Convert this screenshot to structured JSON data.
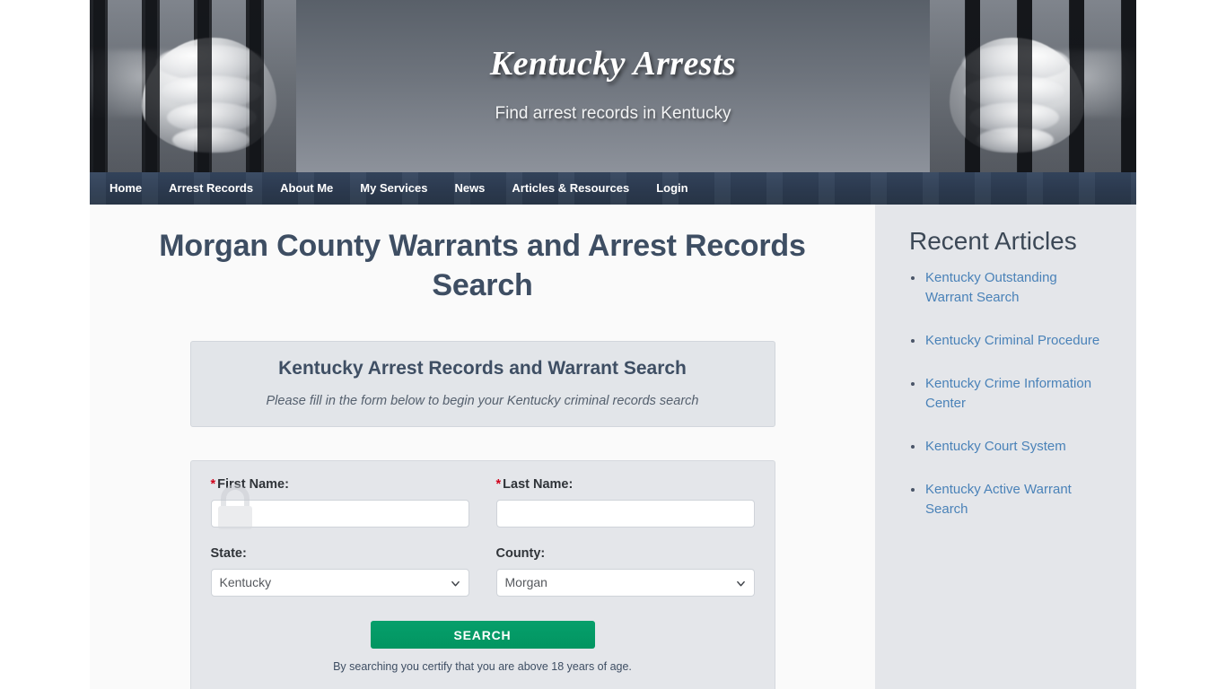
{
  "site": {
    "title": "Kentucky Arrests",
    "tagline": "Find arrest records in Kentucky"
  },
  "nav": {
    "items": [
      {
        "label": "Home"
      },
      {
        "label": "Arrest Records"
      },
      {
        "label": "About Me"
      },
      {
        "label": "My Services"
      },
      {
        "label": "News"
      },
      {
        "label": "Articles & Resources"
      },
      {
        "label": "Login"
      }
    ]
  },
  "main": {
    "page_title": "Morgan County Warrants and Arrest Records Search",
    "intro": {
      "title": "Kentucky Arrest Records and Warrant Search",
      "subtitle": "Please fill in the form below to begin your Kentucky criminal records search"
    },
    "form": {
      "first_name": {
        "label": "First Name:",
        "required_marker": "*",
        "value": "",
        "placeholder": ""
      },
      "last_name": {
        "label": "Last Name:",
        "required_marker": "*",
        "value": "",
        "placeholder": ""
      },
      "state": {
        "label": "State:",
        "value": "Kentucky"
      },
      "county": {
        "label": "County:",
        "value": "Morgan"
      },
      "search_button": "SEARCH",
      "disclaimer": "By searching you certify that you are above 18 years of age."
    }
  },
  "sidebar": {
    "title": "Recent Articles",
    "articles": [
      {
        "label": "Kentucky Outstanding Warrant Search"
      },
      {
        "label": "Kentucky Criminal Procedure"
      },
      {
        "label": "Kentucky Crime Information Center"
      },
      {
        "label": "Kentucky Court System"
      },
      {
        "label": "Kentucky Active Warrant Search"
      }
    ]
  },
  "colors": {
    "nav_bg": "#2d3c52",
    "heading": "#3e4e63",
    "link": "#4a82b8",
    "button_green": "#029b66",
    "required_red": "#d0021b",
    "sidebar_bg": "#e4e6ea",
    "panel_bg": "#e2e5e9"
  }
}
